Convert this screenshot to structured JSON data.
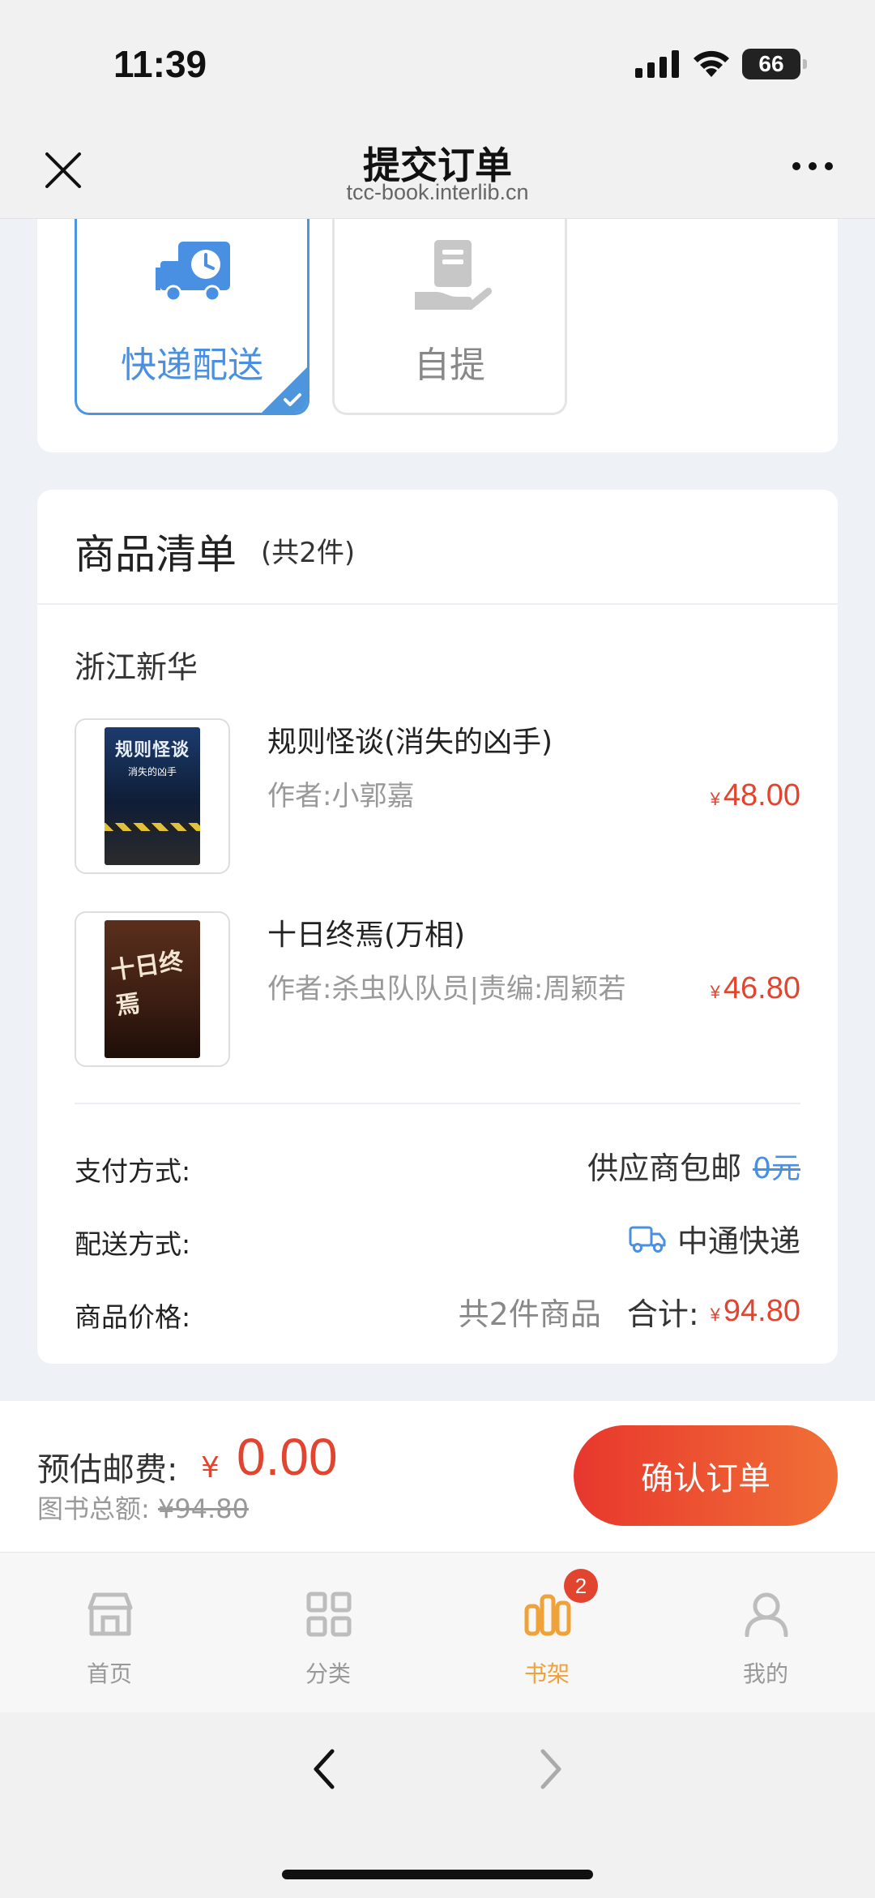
{
  "status_bar": {
    "time": "11:39",
    "battery": "66"
  },
  "header": {
    "title": "提交订单",
    "url": "tcc-book.interlib.cn"
  },
  "delivery": {
    "options": [
      {
        "label": "快递配送",
        "icon": "delivery-truck-clock-icon",
        "selected": true
      },
      {
        "label": "自提",
        "icon": "hand-document-icon",
        "selected": false
      }
    ]
  },
  "goods": {
    "title": "商品清单",
    "count": "(共2件)",
    "store": "浙江新华",
    "items": [
      {
        "title": "规则怪谈(消失的凶手)",
        "author": "作者:小郭嘉",
        "price_symbol": "¥",
        "price": "48.00",
        "cover_text": "规则怪谈",
        "cover_sub": "消失的凶手"
      },
      {
        "title": "十日终焉(万相)",
        "author": "作者:杀虫队队员|责编:周颖若",
        "price_symbol": "¥",
        "price": "46.80",
        "cover_text": "十日终焉"
      }
    ],
    "payment": {
      "label": "支付方式:",
      "value": "供应商包邮",
      "struck": "0元"
    },
    "shipping": {
      "label": "配送方式:",
      "value": "中通快递"
    },
    "price": {
      "label": "商品价格:",
      "count_text": "共2件商品",
      "total_label": "合计:",
      "total_symbol": "¥",
      "total": "94.80"
    }
  },
  "pay_bar": {
    "label": "预估邮费:",
    "symbol": "¥",
    "amount": "0.00",
    "sub_label": "图书总额:",
    "sub_value": "¥94.80",
    "confirm": "确认订单"
  },
  "tabs": [
    {
      "label": "首页",
      "icon": "store-icon",
      "active": false
    },
    {
      "label": "分类",
      "icon": "grid-icon",
      "active": false
    },
    {
      "label": "书架",
      "icon": "bookshelf-icon",
      "active": true,
      "badge": "2"
    },
    {
      "label": "我的",
      "icon": "user-icon",
      "active": false
    }
  ],
  "colors": {
    "accent_blue": "#4a90e2",
    "price_red": "#e2452f",
    "active_tab": "#f0a23a"
  }
}
